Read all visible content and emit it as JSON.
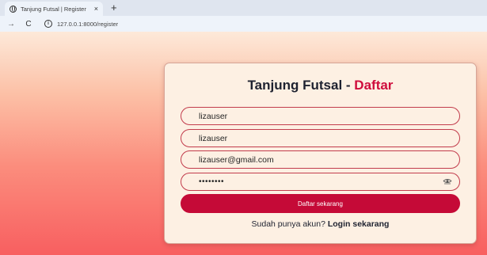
{
  "browser": {
    "tab_title": "Tanjung Futsal | Register",
    "tab_close": "×",
    "new_tab": "+",
    "back": "→",
    "reload": "C",
    "url": "127.0.0.1:8000/register"
  },
  "form": {
    "title_main": "Tanjung Futsal - ",
    "title_accent": "Daftar",
    "name_value": "lizauser",
    "username_value": "lizauser",
    "email_value": "lizauser@gmail.com",
    "password_mask": "••••••••",
    "submit_label": "Daftar sekarang",
    "login_prompt": "Sudah punya akun? ",
    "login_link": "Login sekarang"
  },
  "colors": {
    "accent": "#cf0c3c",
    "button": "#c50a37",
    "card": "#fdf0e3",
    "field_border": "#c23c4c"
  }
}
